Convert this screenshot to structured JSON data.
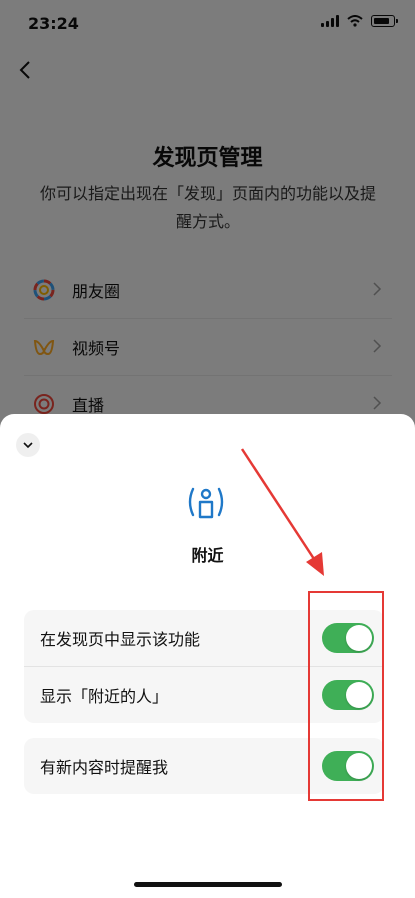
{
  "status_bar": {
    "time": "23:24"
  },
  "page": {
    "title": "发现页管理",
    "description": "你可以指定出现在「发现」页面内的功能以及提醒方式。",
    "items": [
      {
        "label": "朋友圈",
        "icon": "moments-icon"
      },
      {
        "label": "视频号",
        "icon": "channels-icon"
      },
      {
        "label": "直播",
        "icon": "live-icon"
      }
    ]
  },
  "sheet": {
    "feature_name": "附近",
    "feature_icon": "nearby-person-icon",
    "group1": [
      {
        "label": "在发现页中显示该功能",
        "on": true
      },
      {
        "label": "显示「附近的人」",
        "on": true
      }
    ],
    "group2": [
      {
        "label": "有新内容时提醒我",
        "on": true
      }
    ]
  },
  "colors": {
    "toggle_on": "#3faf57",
    "annotation": "#e53935",
    "accent_icon": "#1f78c8"
  }
}
